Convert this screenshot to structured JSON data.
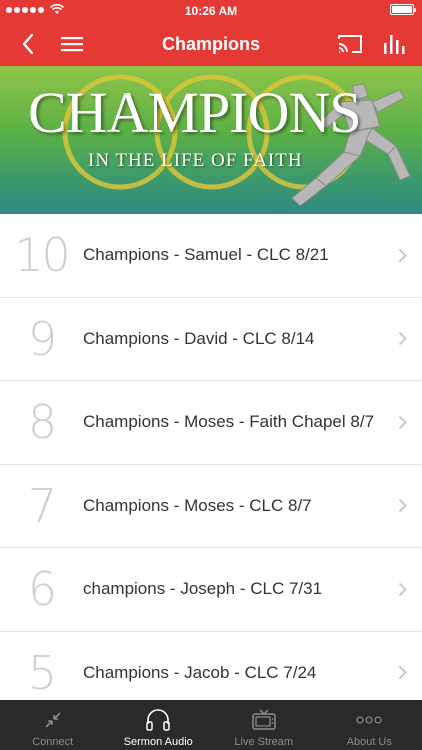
{
  "status_bar": {
    "time": "10:26 AM"
  },
  "nav": {
    "title": "Champions"
  },
  "banner": {
    "title": "CHAMPIONS",
    "subtitle": "IN THE LIFE OF FAITH"
  },
  "sermons": [
    {
      "number": "10",
      "title": "Champions - Samuel - CLC 8/21"
    },
    {
      "number": "9",
      "title": "Champions - David - CLC 8/14"
    },
    {
      "number": "8",
      "title": "Champions - Moses - Faith Chapel 8/7"
    },
    {
      "number": "7",
      "title": "Champions - Moses - CLC 8/7"
    },
    {
      "number": "6",
      "title": "champions - Joseph - CLC 7/31"
    },
    {
      "number": "5",
      "title": "Champions - Jacob - CLC 7/24"
    }
  ],
  "tabs": [
    {
      "label": "Connect",
      "icon": "connect-icon"
    },
    {
      "label": "Sermon Audio",
      "icon": "headphones-icon"
    },
    {
      "label": "Live Stream",
      "icon": "tv-icon"
    },
    {
      "label": "About Us",
      "icon": "more-icon"
    }
  ],
  "colors": {
    "accent": "#e53935",
    "tab_bar": "#2a2a2a",
    "tab_active": "#ffffff",
    "tab_inactive": "#8c8c8c",
    "banner_top": "#8fc449",
    "banner_bottom": "#2f8a82"
  }
}
